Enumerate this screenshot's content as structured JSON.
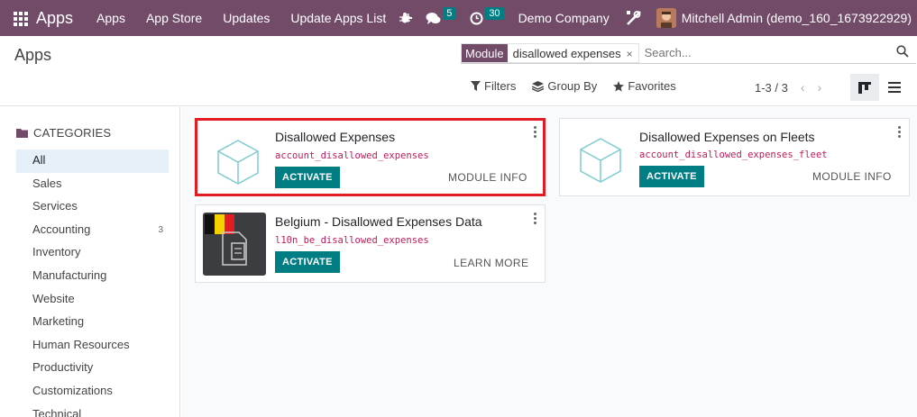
{
  "navbar": {
    "brand": "Apps",
    "menu": [
      "Apps",
      "App Store",
      "Updates",
      "Update Apps List"
    ],
    "plus_icon": "+",
    "messages_count": "5",
    "activities_count": "30",
    "company": "Demo Company",
    "user": "Mitchell Admin (demo_160_1673922929)"
  },
  "control": {
    "breadcrumb": "Apps",
    "facet_label": "Module",
    "facet_value": "disallowed expenses",
    "facet_close": "×",
    "search_placeholder": "Search...",
    "filters_label": "Filters",
    "groupby_label": "Group By",
    "favorites_label": "Favorites",
    "pager": "1-3 / 3",
    "pager_prev": "‹",
    "pager_next": "›"
  },
  "sidebar": {
    "header": "CATEGORIES",
    "items": [
      {
        "label": "All",
        "active": true,
        "count": ""
      },
      {
        "label": "Sales",
        "count": ""
      },
      {
        "label": "Services",
        "count": ""
      },
      {
        "label": "Accounting",
        "count": "3"
      },
      {
        "label": "Inventory",
        "count": ""
      },
      {
        "label": "Manufacturing",
        "count": ""
      },
      {
        "label": "Website",
        "count": ""
      },
      {
        "label": "Marketing",
        "count": ""
      },
      {
        "label": "Human Resources",
        "count": ""
      },
      {
        "label": "Productivity",
        "count": ""
      },
      {
        "label": "Customizations",
        "count": ""
      },
      {
        "label": "Technical",
        "count": ""
      }
    ]
  },
  "cards": [
    {
      "title": "Disallowed Expenses",
      "tech": "account_disallowed_expenses",
      "button": "ACTIVATE",
      "link": "MODULE INFO"
    },
    {
      "title": "Disallowed Expenses on Fleets",
      "tech": "account_disallowed_expenses_fleet",
      "button": "ACTIVATE",
      "link": "MODULE INFO"
    },
    {
      "title": "Belgium - Disallowed Expenses Data",
      "tech": "l10n_be_disallowed_expenses",
      "button": "ACTIVATE",
      "link": "LEARN MORE"
    }
  ],
  "colors": {
    "brand": "#714B67",
    "accent": "#017e84",
    "highlight": "#e31b23",
    "tech_name": "#c2185b"
  }
}
